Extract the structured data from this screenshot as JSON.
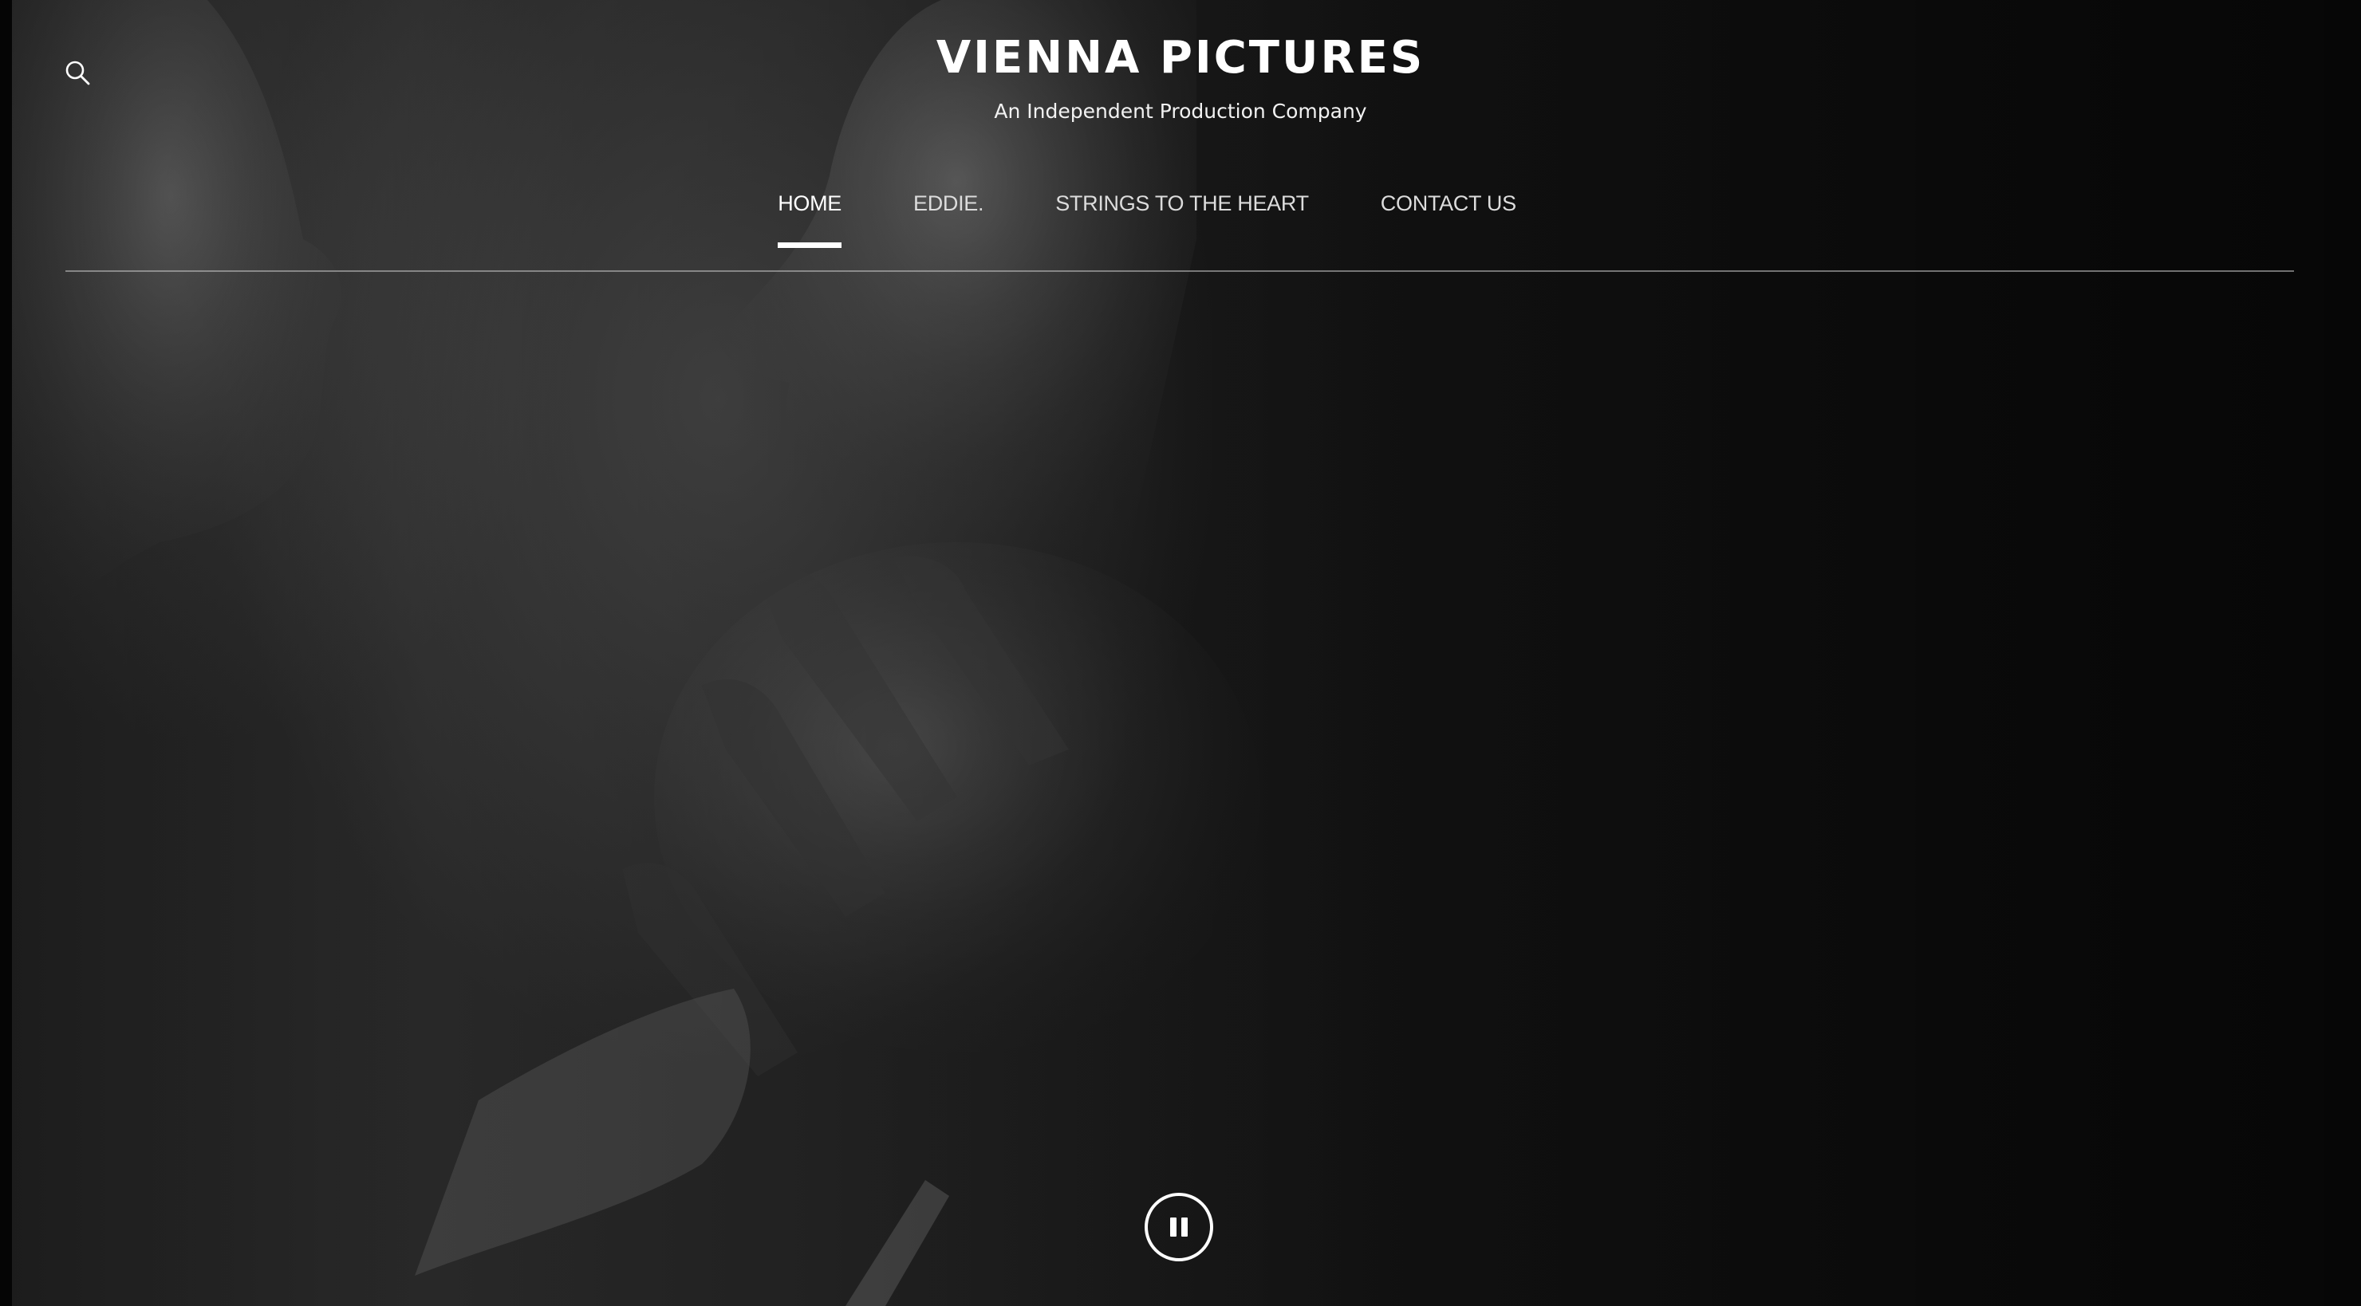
{
  "site": {
    "title": "VIENNA PICTURES",
    "tagline": "An Independent Production Company"
  },
  "header": {
    "search_icon": "search-icon"
  },
  "nav": {
    "items": [
      {
        "label": "HOME",
        "active": true
      },
      {
        "label": "EDDIE.",
        "active": false
      },
      {
        "label": "STRINGS TO THE HEART",
        "active": false
      },
      {
        "label": "CONTACT US",
        "active": false
      }
    ]
  },
  "hero": {
    "background": "black-and-white video still",
    "control_icon": "pause-icon"
  },
  "colors": {
    "text": "#ffffff",
    "nav_text": "#dcdcdc",
    "divider": "#c8c8c8",
    "background": "#0b0b0b"
  }
}
